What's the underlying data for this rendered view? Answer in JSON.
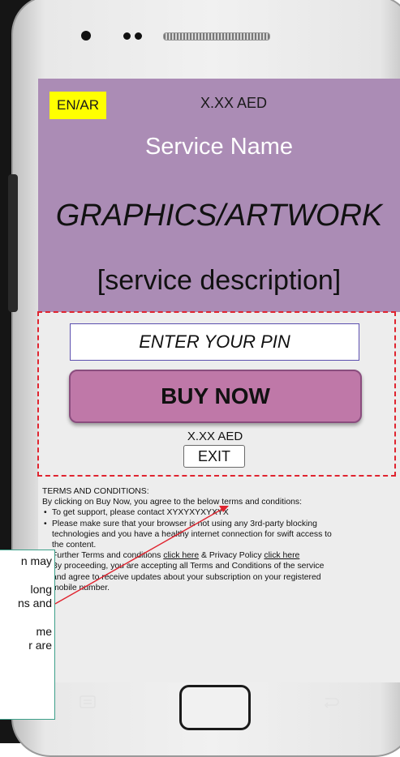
{
  "screen": {
    "language_toggle": "EN/AR",
    "price_top": "X.XX AED",
    "service_name": "Service Name",
    "graphics_label": "GRAPHICS/ARTWORK",
    "service_description": "[service description]"
  },
  "form": {
    "pin_placeholder": "ENTER YOUR PIN",
    "buy_label": "BUY NOW",
    "price_bottom": "X.XX AED",
    "exit_label": "EXIT"
  },
  "terms": {
    "heading": "TERMS AND CONDITIONS:",
    "intro": "By clicking on Buy Now, you agree to the below terms and conditions:",
    "support": "To get support, please contact XYXYXYXYXYX",
    "browser_1": "Please make sure that your browser is not using any 3rd-party blocking",
    "browser_2": "technologies and you have a healthy internet connection for swift access to",
    "browser_3": "the content.",
    "further_prefix": "Further Terms and conditions ",
    "further_link": "click here",
    "privacy_prefix": " & Privacy Policy ",
    "privacy_link": "click here",
    "proceed_1": "By proceeding, you are accepting all Terms and Conditions of the service",
    "proceed_2": "and agree to receive updates about your subscription on your registered",
    "proceed_3": "mobile number."
  },
  "note": {
    "line1": "n may",
    "line2": "long",
    "line3": "ns and",
    "line4": "me",
    "line5": "r are"
  },
  "colors": {
    "hero_bg": "#ab8cb5",
    "lang_badge": "#ffff00",
    "buy_button": "#bf78a8",
    "dashed_border": "#e0242f",
    "arrow": "#e0242f",
    "note_border": "#3da08a"
  },
  "icons": {
    "menu": "menu-icon",
    "back": "back-icon",
    "home": "home-button"
  }
}
